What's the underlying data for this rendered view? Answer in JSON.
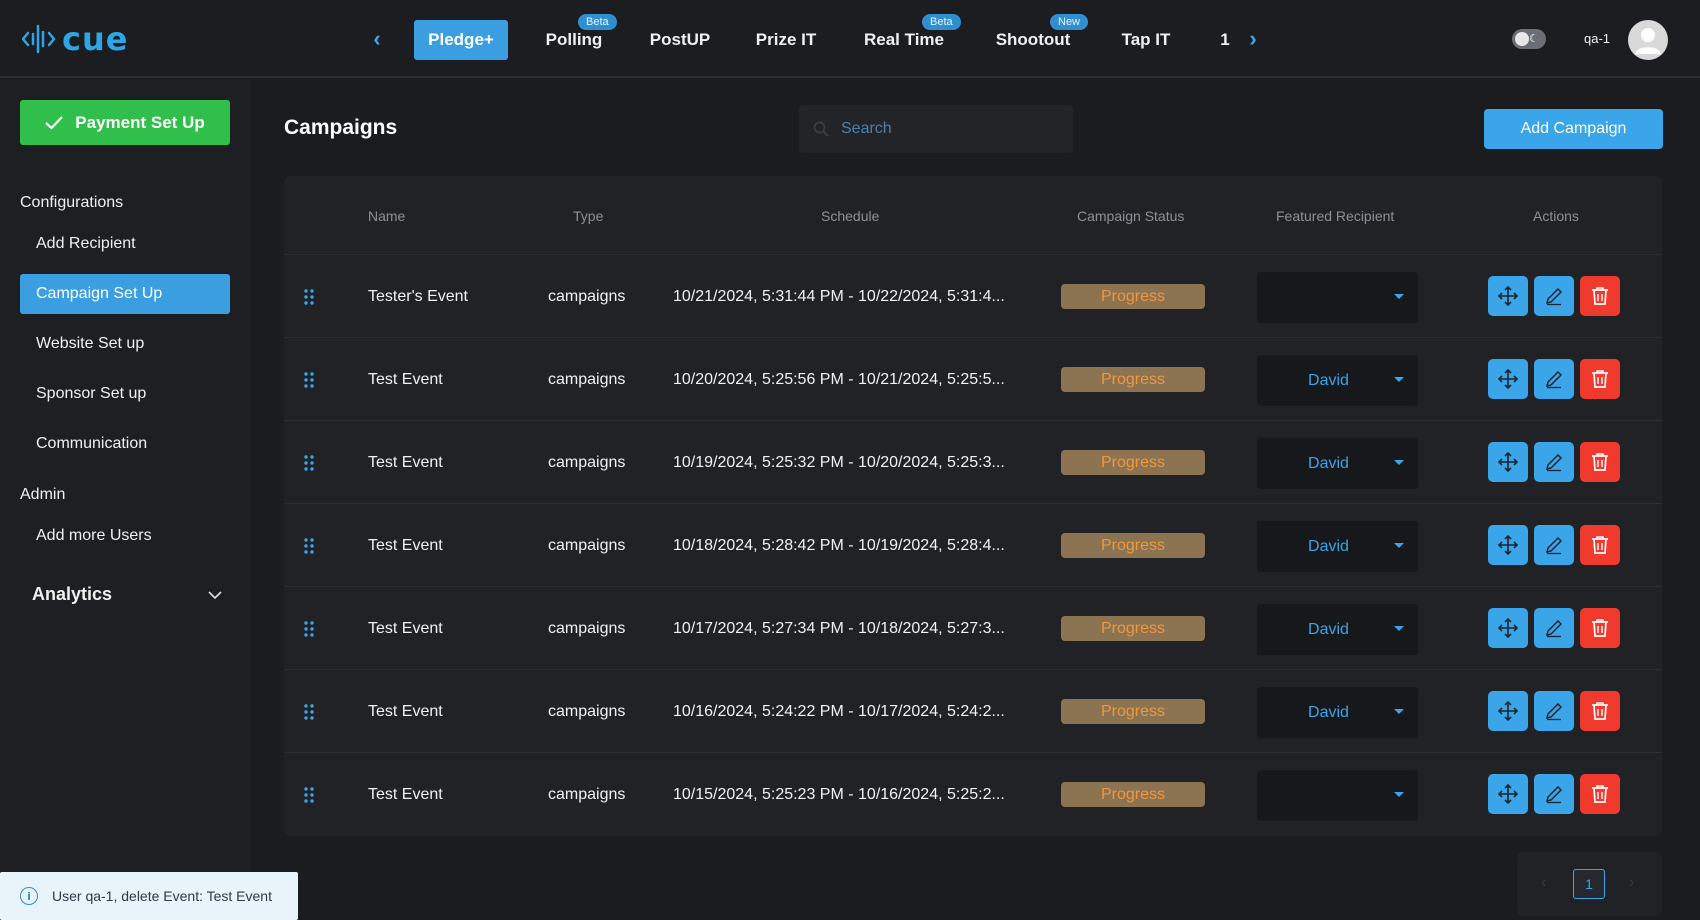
{
  "brand": {
    "logo_text": "cue"
  },
  "topnav": {
    "tabs": [
      {
        "label": "Pledge+",
        "badge": ""
      },
      {
        "label": "Polling",
        "badge": "Beta"
      },
      {
        "label": "PostUP",
        "badge": ""
      },
      {
        "label": "Prize IT",
        "badge": ""
      },
      {
        "label": "Real Time",
        "badge": "Beta"
      },
      {
        "label": "Shootout",
        "badge": "New"
      },
      {
        "label": "Tap IT",
        "badge": ""
      },
      {
        "label": "1",
        "badge": ""
      }
    ],
    "active_tab": "Pledge+",
    "username": "qa-1"
  },
  "sidebar": {
    "payment_button": "Payment Set Up",
    "configurations_title": "Configurations",
    "config_items": [
      {
        "label": "Add Recipient"
      },
      {
        "label": "Campaign Set Up"
      },
      {
        "label": "Website Set up"
      },
      {
        "label": "Sponsor Set up"
      },
      {
        "label": "Communication"
      }
    ],
    "active_item": "Campaign Set Up",
    "admin_title": "Admin",
    "admin_items": [
      {
        "label": "Add more Users"
      }
    ],
    "analytics_label": "Analytics"
  },
  "main": {
    "title": "Campaigns",
    "search_placeholder": "Search",
    "add_button": "Add Campaign"
  },
  "table": {
    "headers": {
      "name": "Name",
      "type": "Type",
      "schedule": "Schedule",
      "status": "Campaign Status",
      "recipient": "Featured Recipient",
      "actions": "Actions"
    },
    "rows": [
      {
        "name": "Tester's Event",
        "type": "campaigns",
        "schedule": "10/21/2024, 5:31:44 PM - 10/22/2024, 5:31:4...",
        "status": "Progress",
        "recipient": ""
      },
      {
        "name": "Test Event",
        "type": "campaigns",
        "schedule": "10/20/2024, 5:25:56 PM - 10/21/2024, 5:25:5...",
        "status": "Progress",
        "recipient": "David"
      },
      {
        "name": "Test Event",
        "type": "campaigns",
        "schedule": "10/19/2024, 5:25:32 PM - 10/20/2024, 5:25:3...",
        "status": "Progress",
        "recipient": "David"
      },
      {
        "name": "Test Event",
        "type": "campaigns",
        "schedule": "10/18/2024, 5:28:42 PM - 10/19/2024, 5:28:4...",
        "status": "Progress",
        "recipient": "David"
      },
      {
        "name": "Test Event",
        "type": "campaigns",
        "schedule": "10/17/2024, 5:27:34 PM - 10/18/2024, 5:27:3...",
        "status": "Progress",
        "recipient": "David"
      },
      {
        "name": "Test Event",
        "type": "campaigns",
        "schedule": "10/16/2024, 5:24:22 PM - 10/17/2024, 5:24:2...",
        "status": "Progress",
        "recipient": "David"
      },
      {
        "name": "Test Event",
        "type": "campaigns",
        "schedule": "10/15/2024, 5:25:23 PM - 10/16/2024, 5:25:2...",
        "status": "Progress",
        "recipient": ""
      }
    ]
  },
  "pagination": {
    "current_page": "1"
  },
  "toast": {
    "message": "User qa-1, delete Event: Test Event"
  },
  "colors": {
    "accent": "#3aa5e8",
    "success": "#2fbf4a",
    "danger": "#f03a2e",
    "status_bg": "#8c7352",
    "status_text": "#f0983a",
    "background": "#1b1c1f"
  }
}
